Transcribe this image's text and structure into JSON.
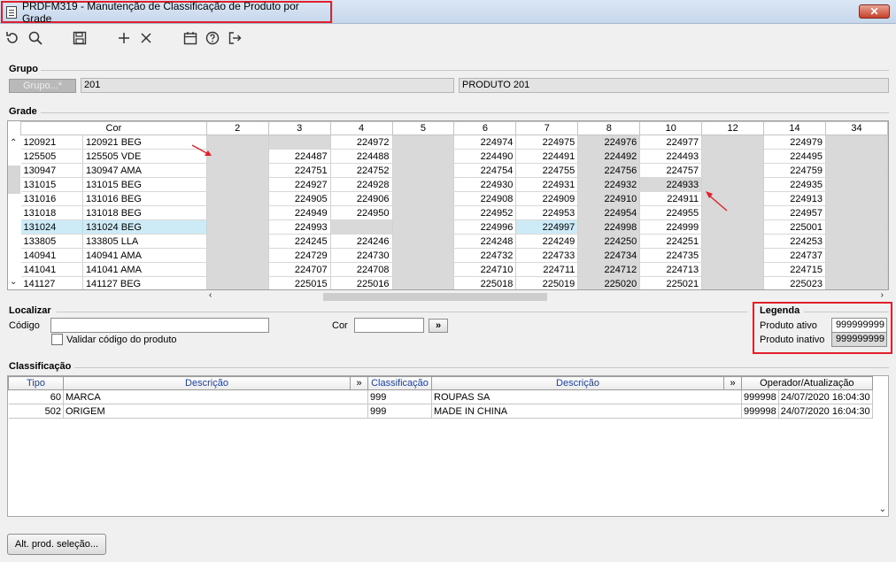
{
  "window": {
    "title": "PRDFM319 - Manutenção de Classificação de Produto por Grade",
    "close_label": "✕"
  },
  "toolbar": {
    "icons": [
      "undo-icon",
      "search-icon",
      "save-icon",
      "add-icon",
      "delete-icon",
      "calendar-icon",
      "help-icon",
      "exit-icon"
    ]
  },
  "grupo": {
    "section_label": "Grupo",
    "button_label": "Grupo...*",
    "code": "201",
    "description": "PRODUTO 201"
  },
  "grade": {
    "section_label": "Grade",
    "cor_header": "Cor",
    "size_headers": [
      "2",
      "3",
      "4",
      "5",
      "6",
      "7",
      "8",
      "10",
      "12",
      "14",
      "34"
    ],
    "rows": [
      {
        "codigo": "120921",
        "cor": "120921 BEG",
        "cells": [
          "",
          "",
          "224972",
          "",
          "224974",
          "224975",
          "224976",
          "224977",
          "",
          "224979",
          ""
        ]
      },
      {
        "codigo": "125505",
        "cor": "125505 VDE",
        "cells": [
          "",
          "224487",
          "224488",
          "",
          "224490",
          "224491",
          "224492",
          "224493",
          "",
          "224495",
          ""
        ]
      },
      {
        "codigo": "130947",
        "cor": "130947 AMA",
        "cells": [
          "",
          "224751",
          "224752",
          "",
          "224754",
          "224755",
          "224756",
          "224757",
          "",
          "224759",
          ""
        ]
      },
      {
        "codigo": "131015",
        "cor": "131015 BEG",
        "cells": [
          "",
          "224927",
          "224928",
          "",
          "224930",
          "224931",
          "224932",
          "224933",
          "",
          "224935",
          ""
        ]
      },
      {
        "codigo": "131016",
        "cor": "131016 BEG",
        "cells": [
          "",
          "224905",
          "224906",
          "",
          "224908",
          "224909",
          "224910",
          "224911",
          "",
          "224913",
          ""
        ]
      },
      {
        "codigo": "131018",
        "cor": "131018 BEG",
        "cells": [
          "",
          "224949",
          "224950",
          "",
          "224952",
          "224953",
          "224954",
          "224955",
          "",
          "224957",
          ""
        ]
      },
      {
        "codigo": "131024",
        "cor": "131024 BEG",
        "cells": [
          "",
          "224993",
          "",
          "",
          "224996",
          "224997",
          "224998",
          "224999",
          "",
          "225001",
          ""
        ]
      },
      {
        "codigo": "133805",
        "cor": "133805 LLA",
        "cells": [
          "",
          "224245",
          "224246",
          "",
          "224248",
          "224249",
          "224250",
          "224251",
          "",
          "224253",
          ""
        ]
      },
      {
        "codigo": "140941",
        "cor": "140941 AMA",
        "cells": [
          "",
          "224729",
          "224730",
          "",
          "224732",
          "224733",
          "224734",
          "224735",
          "",
          "224737",
          ""
        ]
      },
      {
        "codigo": "141041",
        "cor": "141041 AMA",
        "cells": [
          "",
          "224707",
          "224708",
          "",
          "224710",
          "224711",
          "224712",
          "224713",
          "",
          "224715",
          ""
        ]
      },
      {
        "codigo": "141127",
        "cor": "141127 BEG",
        "cells": [
          "",
          "225015",
          "225016",
          "",
          "225018",
          "225019",
          "225020",
          "225021",
          "",
          "225023",
          ""
        ]
      }
    ]
  },
  "localizar": {
    "section_label": "Localizar",
    "codigo_label": "Código",
    "codigo_value": "",
    "validar_label": "Validar código do produto",
    "cor_label": "Cor",
    "cor_value": "",
    "go_label": "»"
  },
  "legenda": {
    "section_label": "Legenda",
    "ativo_label": "Produto ativo",
    "ativo_value": "999999999",
    "inativo_label": "Produto inativo",
    "inativo_value": "999999999"
  },
  "classificacao": {
    "section_label": "Classificação",
    "headers": {
      "tipo": "Tipo",
      "descricao": "Descrição",
      "more1": "»",
      "classificacao": "Classificação",
      "descricao2": "Descrição",
      "more2": "»",
      "operador": "Operador/Atualização"
    },
    "rows": [
      {
        "tipo": "60",
        "descricao": "MARCA",
        "classificacao": "999",
        "descricao2": "ROUPAS SA",
        "operador": "999998",
        "atualizacao": "24/07/2020 16:04:30"
      },
      {
        "tipo": "502",
        "descricao": "ORIGEM",
        "classificacao": "999",
        "descricao2": "MADE IN CHINA",
        "operador": "999998",
        "atualizacao": "24/07/2020 16:04:30"
      }
    ]
  },
  "footer": {
    "alt_button_label": "Alt. prod. seleção..."
  }
}
